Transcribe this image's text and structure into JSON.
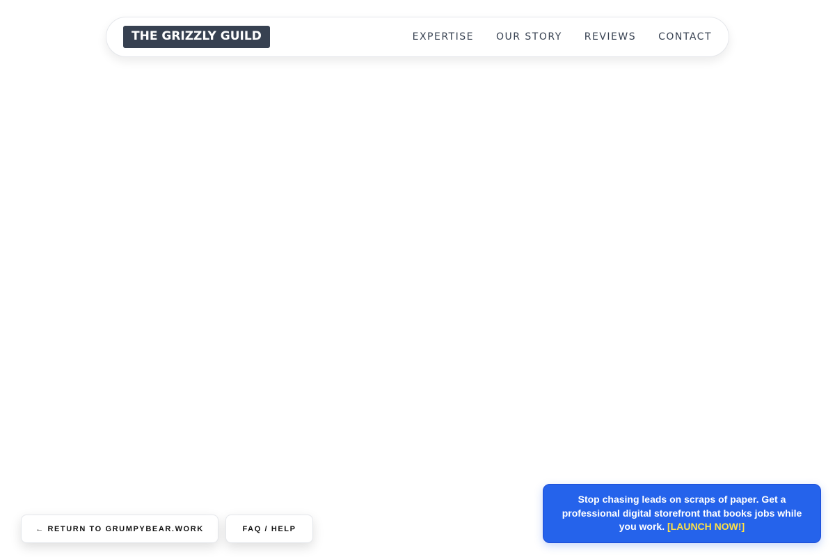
{
  "header": {
    "logo": "THE GRIZZLY GUILD",
    "nav": [
      "EXPERTISE",
      "OUR STORY",
      "REVIEWS",
      "CONTACT"
    ]
  },
  "footer_buttons": {
    "return_label": "← RETURN TO GRUMPYBEAR.WORK",
    "faq_label": "FAQ / HELP"
  },
  "promo": {
    "text": "Stop chasing leads on scraps of paper. Get a professional digital storefront that books jobs while you work.",
    "cta": "[LAUNCH NOW!]",
    "background_color": "#2563eb",
    "cta_color": "#fde047"
  }
}
